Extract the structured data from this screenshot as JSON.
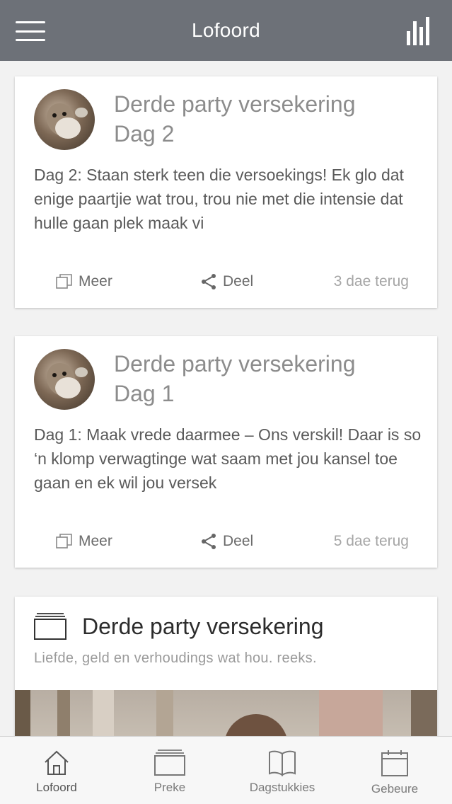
{
  "header": {
    "title": "Lofoord"
  },
  "cards": [
    {
      "title_line1": "Derde party versekering",
      "title_line2": "Dag 2",
      "excerpt": "Dag 2: Staan sterk teen die versoekings! Ek glo dat enige paartjie wat trou, trou nie met die intensie dat hulle gaan plek maak vi",
      "more_label": "Meer",
      "share_label": "Deel",
      "time_ago": "3 dae terug"
    },
    {
      "title_line1": "Derde party versekering",
      "title_line2": "Dag 1",
      "excerpt": "Dag 1: Maak vrede daarmee – Ons verskil! Daar is so ‘n klomp verwagtinge wat saam met jou kansel toe gaan en ek wil jou versek",
      "more_label": "Meer",
      "share_label": "Deel",
      "time_ago": "5 dae terug"
    }
  ],
  "series": {
    "title": "Derde party versekering",
    "subtitle": "Liefde, geld en verhoudings wat hou. reeks."
  },
  "tabbar": {
    "items": [
      {
        "label": "Lofoord",
        "icon": "home-icon",
        "active": true
      },
      {
        "label": "Preke",
        "icon": "stack-icon",
        "active": false
      },
      {
        "label": "Dagstukkies",
        "icon": "book-icon",
        "active": false
      },
      {
        "label": "Gebeure",
        "icon": "calendar-icon",
        "active": false
      }
    ]
  },
  "colors": {
    "header_bg": "#6d7178",
    "page_bg": "#f2f2f2",
    "card_bg": "#ffffff",
    "title_gray": "#8c8c8c",
    "text_gray": "#5a5a5a"
  }
}
